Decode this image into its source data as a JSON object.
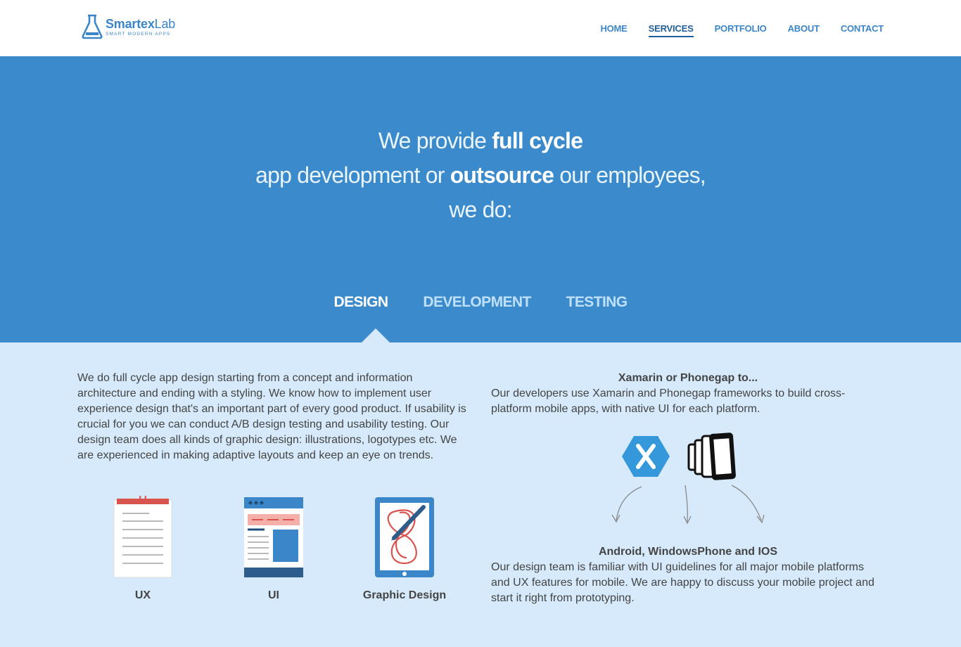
{
  "brand": {
    "name_bold": "Smartex",
    "name_light": "Lab",
    "tagline": "SMART MODERN APPS"
  },
  "nav": {
    "items": [
      {
        "label": "HOME"
      },
      {
        "label": "SERVICES"
      },
      {
        "label": "PORTFOLIO"
      },
      {
        "label": "ABOUT"
      },
      {
        "label": "CONTACT"
      }
    ],
    "active": "SERVICES"
  },
  "hero": {
    "line1_pre": "We provide ",
    "line1_bold": "full cycle",
    "line2_pre": "app development or ",
    "line2_bold": "outsource",
    "line2_post": " our employees,",
    "line3": "we do:"
  },
  "tabs": {
    "items": [
      {
        "label": "DESIGN"
      },
      {
        "label": "DEVELOPMENT"
      },
      {
        "label": "TESTING"
      }
    ],
    "active": "DESIGN"
  },
  "design": {
    "description": "We do full cycle app design starting from a concept and information architecture and ending with a styling. We know how to implement user experience design that's an important part of every good product. If usability is crucial for you we can conduct A/B design testing and usability testing. Our design team does all kinds of graphic design: illustrations, logotypes etc. We are experienced in making adaptive layouts and keep an eye on trends.",
    "services": [
      {
        "label": "UX",
        "icon": "clipboard-icon"
      },
      {
        "label": "UI",
        "icon": "browser-layout-icon"
      },
      {
        "label": "Graphic Design",
        "icon": "tablet-drawing-icon"
      }
    ]
  },
  "frameworks": {
    "title": "Xamarin or Phonegap to...",
    "text": "Our developers use Xamarin and Phonegap frameworks to build cross-platform mobile apps, with native UI for each platform.",
    "icons": [
      "xamarin-icon",
      "phonegap-icon"
    ]
  },
  "platforms": {
    "title": "Android, WindowsPhone and IOS",
    "text": "Our design team is familiar with UI guidelines for all major mobile platforms and UX features for mobile. We are happy to discuss your mobile project and start it right from prototyping."
  },
  "colors": {
    "hero_bg": "#3b8acb",
    "content_bg": "#d6eafb",
    "accent": "#3b86c8",
    "ux_red": "#d9534f",
    "xamarin_blue": "#3498db"
  }
}
